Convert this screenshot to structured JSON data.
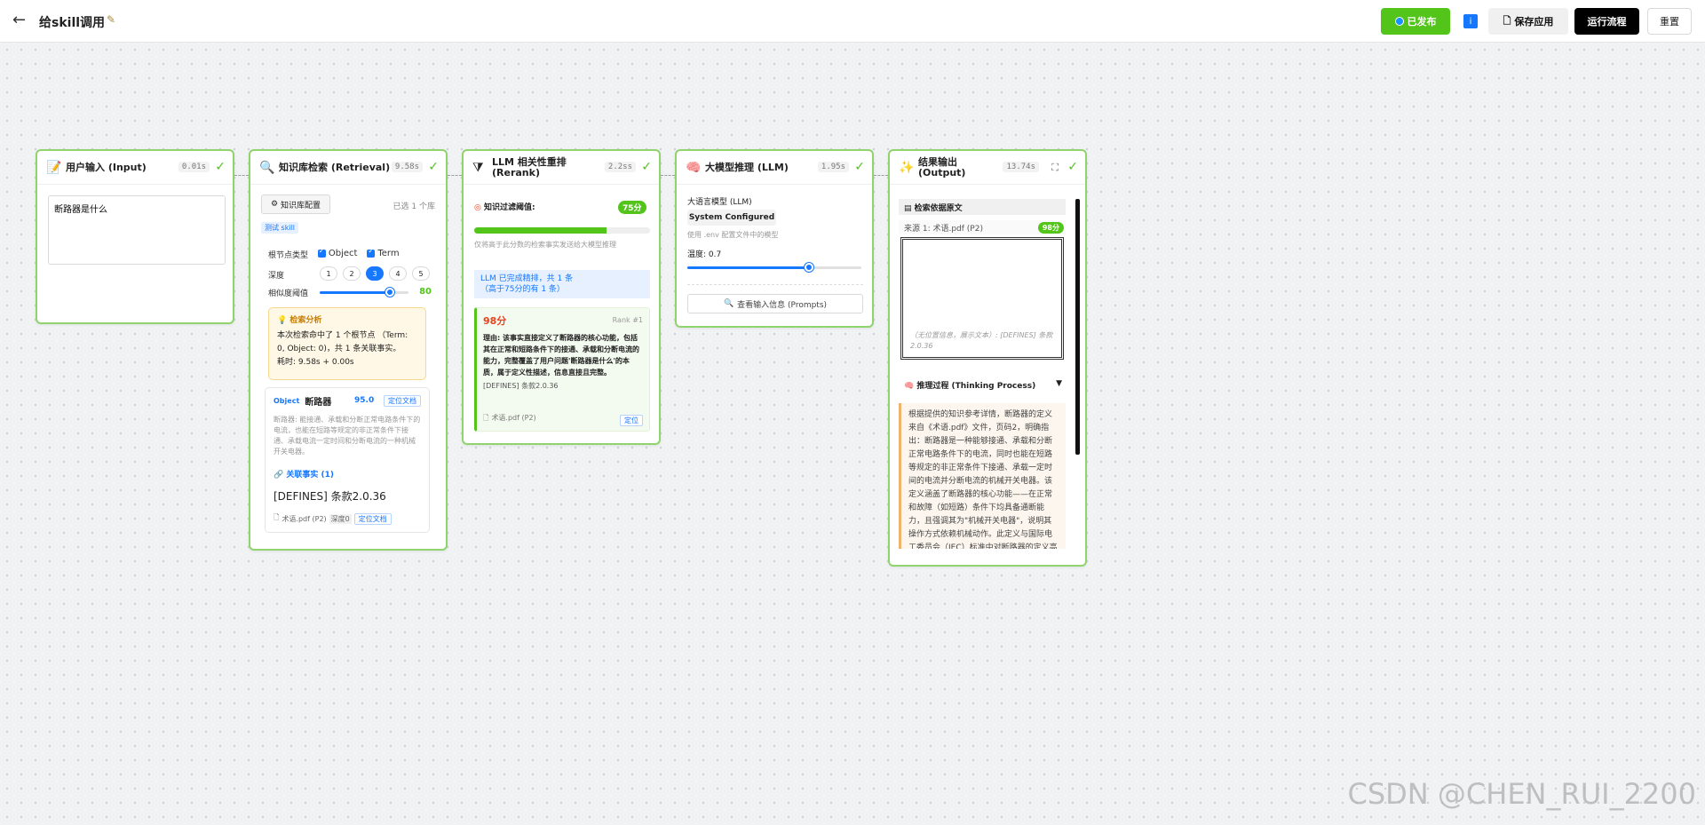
{
  "app": {
    "back_icon": "arrow-left-icon",
    "title": "给skill调用",
    "edit_icon": "pencil-icon"
  },
  "toolbar": {
    "published_label": "已发布",
    "info_label": "i",
    "save_label": "保存应用",
    "run_label": "运行流程",
    "reset_label": "重置"
  },
  "nodes": {
    "input": {
      "title": "用户输入 (Input)",
      "time": "0.01s",
      "value": "断路器是什么"
    },
    "retrieval": {
      "title": "知识库检索 (Retrieval)",
      "time": "9.58s",
      "kb_config_label": "知识库配置",
      "selected_count": "已选 1 个库",
      "skill_tag": "测试 skill",
      "root_type_label": "根节点类型",
      "types": [
        "Object",
        "Term"
      ],
      "depth_label": "深度",
      "depth_options": [
        "1",
        "2",
        "3",
        "4",
        "5"
      ],
      "depth_selected": "3",
      "similarity_label": "相似度阈值",
      "similarity_value": "80",
      "analysis_title": "检索分析",
      "analysis_text": "本次检索命中了 1 个根节点 （Term: 0, Object: 0)，共 1 条关联事实。",
      "analysis_time": "耗时: 9.58s + 0.00s",
      "object_tag": "Object",
      "object_name": "断路器",
      "object_score": "95.0",
      "locate_label": "定位文档",
      "object_desc": "断路器: 能接通、承载和分断正常电路条件下的电流，也能在短路等规定的非正常条件下接通、承载电流一定时间和分断电流的一种机械开关电器。",
      "facts_label": "关联事实 (1)",
      "fact_text": "[DEFINES] 条款2.0.36",
      "fact_source": "术语.pdf (P2)",
      "fact_depth": "深度0",
      "fact_locate_label": "定位文档"
    },
    "rerank": {
      "title_line1": "LLM 相关性重排",
      "title_line2": "(Rerank)",
      "time": "2.2ss",
      "threshold_label": "知识过滤阈值:",
      "threshold_value": "75分",
      "threshold_fraction": 0.75,
      "threshold_hint": "仅将高于此分数的检索事实发送给大模型推理",
      "info_line1": "LLM 已完成精排，共 1 条",
      "info_line2": "（高于75分的有 1 条）",
      "rank_score": "98分",
      "rank_no": "Rank #1",
      "rank_reason": "理由: 该事实直接定义了断路器的核心功能，包括其在正常和短路条件下的接通、承载和分断电流的能力，完整覆盖了用户问题'断路器是什么'的本质，属于定义性描述，信息直接且完整。",
      "rank_clause": "[DEFINES] 条款2.0.36",
      "rank_source": "术语.pdf (P2)",
      "rank_locate": "定位"
    },
    "llm": {
      "title": "大模型推理 (LLM)",
      "time": "1.95s",
      "model_label": "大语言模型 (LLM)",
      "model_value": "System Configured",
      "model_hint": "使用 .env 配置文件中的模型",
      "temperature_label": "温度: 0.7",
      "temperature_value": 0.7,
      "prompt_btn_label": "查看输入信息 (Prompts)"
    },
    "output": {
      "title_line1": "结果输出",
      "title_line2": "(Output)",
      "time": "13.74s",
      "evidence_label": "检索依据原文",
      "source_label": "来源 1: 术语.pdf (P2)",
      "source_score": "98分",
      "preview_caption": "（无位置信息，展示文本）: [DEFINES] 条款2.0.36",
      "thinking_label": "推理过程 (Thinking Process)",
      "thinking_text": "根据提供的知识参考详情，断路器的定义来自《术语.pdf》文件，页码2，明确指出：断路器是一种能够接通、承载和分断正常电路条件下的电流，同时也能在短路等规定的非正常条件下接通、承载一定时间的电流并分断电流的机械开关电器。该定义涵盖了断路器的核心功能——在正常和故障（如短路）条件下均具备通断能力，且强调其为\"机械开关电器\"，说明其操作方式依赖机械动作。此定义与国际电工委员会（IEC）标准中对断路器的定义高度一致，属于权威技术"
    }
  },
  "watermark": "CSDN @CHEN_RUI_2200",
  "colors": {
    "accent": "#1677ff",
    "success": "#52c41a",
    "node_border": "#8fd46e",
    "warning_bg": "#fff8e6"
  }
}
